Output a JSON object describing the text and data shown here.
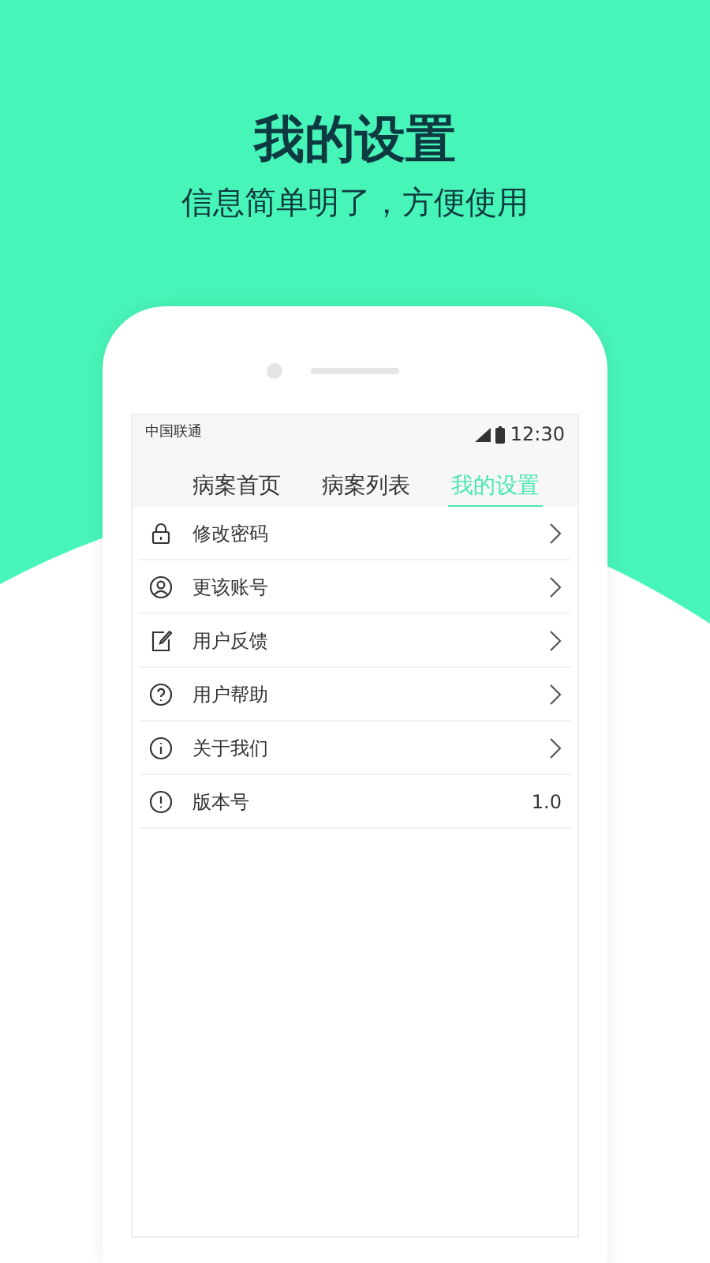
{
  "headline": {
    "title": "我的设置",
    "subtitle": "信息简单明了，方便使用"
  },
  "status_bar": {
    "carrier": "中国联通",
    "time": "12:30"
  },
  "tabs": [
    {
      "label": "病案首页",
      "selected": false
    },
    {
      "label": "病案列表",
      "selected": false
    },
    {
      "label": "我的设置",
      "selected": true
    }
  ],
  "settings": [
    {
      "kind": "link",
      "label": "修改密码"
    },
    {
      "kind": "link",
      "label": "更该账号"
    },
    {
      "kind": "link",
      "label": "用户反馈"
    },
    {
      "kind": "link",
      "label": "用户帮助"
    },
    {
      "kind": "link",
      "label": "关于我们"
    },
    {
      "kind": "value",
      "label": "版本号",
      "value": "1.0"
    }
  ]
}
